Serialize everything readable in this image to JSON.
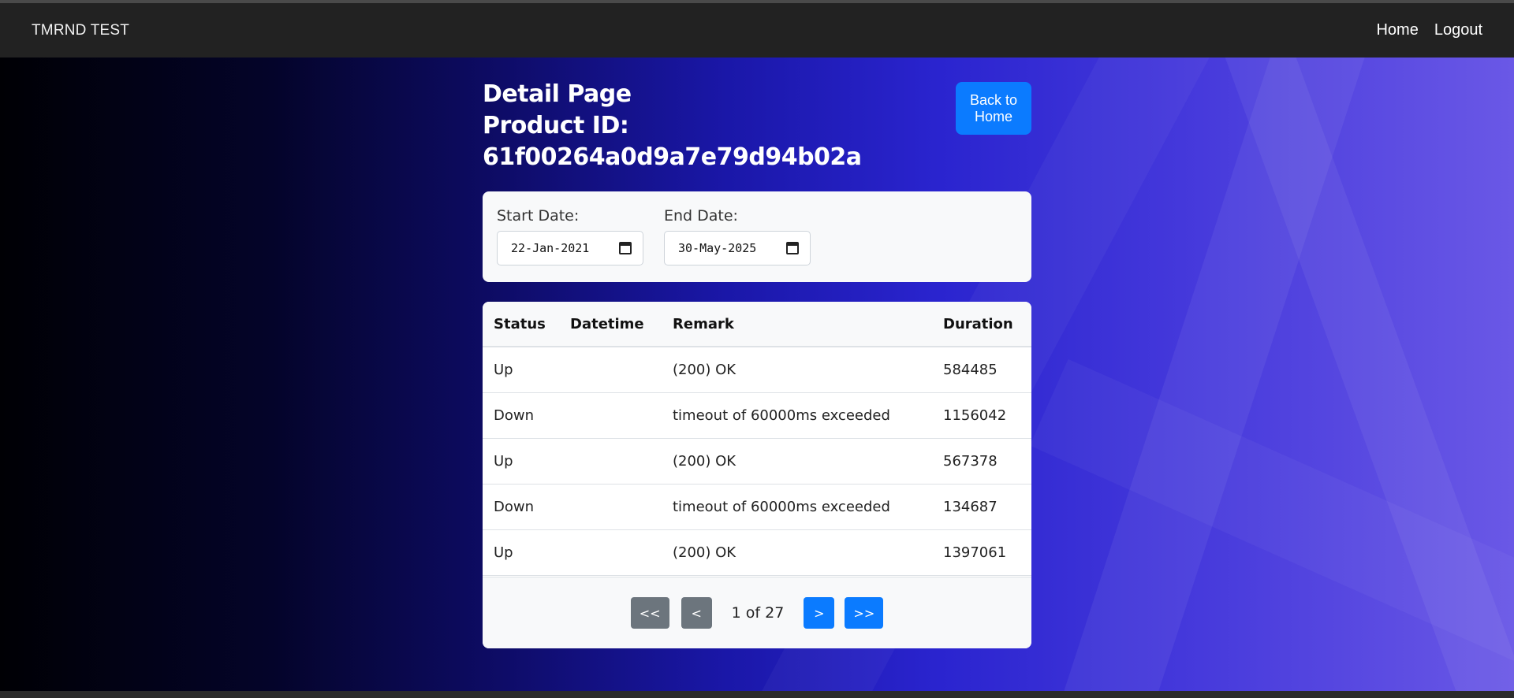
{
  "navbar": {
    "brand": "TMRND TEST",
    "links": [
      "Home",
      "Logout"
    ]
  },
  "header": {
    "title": "Detail Page",
    "product_id": "Product ID: 61f00264a0d9a7e79d94b02a",
    "back_button": "Back to Home"
  },
  "filters": {
    "start_label": "Start Date:",
    "start_value": "22-Jan-2021",
    "end_label": "End Date:",
    "end_value": "30-May-2025"
  },
  "table": {
    "columns": [
      "Status",
      "Datetime",
      "Remark",
      "Duration"
    ],
    "rows": [
      {
        "status": "Up",
        "datetime": "",
        "remark": "(200) OK",
        "duration": "584485"
      },
      {
        "status": "Down",
        "datetime": "",
        "remark": "timeout of 60000ms exceeded",
        "duration": "1156042"
      },
      {
        "status": "Up",
        "datetime": "",
        "remark": "(200) OK",
        "duration": "567378"
      },
      {
        "status": "Down",
        "datetime": "",
        "remark": "timeout of 60000ms exceeded",
        "duration": "134687"
      },
      {
        "status": "Up",
        "datetime": "",
        "remark": "(200) OK",
        "duration": "1397061"
      }
    ]
  },
  "pagination": {
    "first": "<<",
    "prev": "<",
    "info": "1 of 27",
    "next": ">",
    "last": ">>"
  },
  "colors": {
    "navbar": "#222222",
    "primary_button": "#0b7bff",
    "secondary_button": "#6c757d"
  }
}
